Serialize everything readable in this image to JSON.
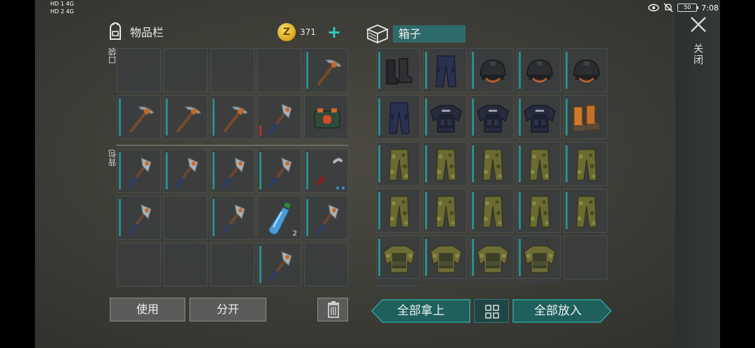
{
  "status": {
    "signal_a": "HD 1  4G",
    "signal_b": "HD 2  4G",
    "battery": "50",
    "time": "7:08"
  },
  "inventory": {
    "title": "物品栏",
    "coins": "371",
    "pocket_label": "口袋",
    "backpack_label": "背包",
    "pocket_slots": [
      {
        "item": "empty"
      },
      {
        "item": "empty"
      },
      {
        "item": "empty"
      },
      {
        "item": "empty"
      },
      {
        "item": "pickaxe",
        "bar": "teal"
      },
      {
        "item": "pickaxe",
        "bar": "teal"
      },
      {
        "item": "pickaxe",
        "bar": "teal"
      },
      {
        "item": "pickaxe",
        "bar": "teal"
      },
      {
        "item": "axe",
        "bar": "red"
      },
      {
        "item": "medkit"
      }
    ],
    "backpack_slots": [
      {
        "item": "axe",
        "bar": "teal"
      },
      {
        "item": "axe",
        "bar": "teal"
      },
      {
        "item": "axe",
        "bar": "teal"
      },
      {
        "item": "axe",
        "bar": "teal"
      },
      {
        "item": "crowbar",
        "bar": "teal"
      },
      {
        "item": "axe",
        "bar": "teal"
      },
      {
        "item": "empty"
      },
      {
        "item": "axe",
        "bar": "teal"
      },
      {
        "item": "water-bottle",
        "qty": "2"
      },
      {
        "item": "axe",
        "bar": "teal"
      },
      {
        "item": "empty"
      },
      {
        "item": "empty"
      },
      {
        "item": "empty"
      },
      {
        "item": "axe",
        "bar": "teal"
      },
      {
        "item": "empty"
      }
    ],
    "use_label": "使用",
    "split_label": "分开"
  },
  "box": {
    "title": "箱子",
    "slots": [
      {
        "item": "boots-black",
        "bar": "teal"
      },
      {
        "item": "pants-navy",
        "bar": "teal"
      },
      {
        "item": "helmet",
        "bar": "teal"
      },
      {
        "item": "helmet",
        "bar": "teal"
      },
      {
        "item": "helmet",
        "bar": "teal"
      },
      {
        "item": "pants-navy",
        "bar": "teal"
      },
      {
        "item": "vest-navy",
        "bar": "teal"
      },
      {
        "item": "vest-navy",
        "bar": "teal"
      },
      {
        "item": "vest-navy",
        "bar": "teal"
      },
      {
        "item": "boots-orange",
        "bar": "teal"
      },
      {
        "item": "pants-camo",
        "bar": "teal"
      },
      {
        "item": "pants-camo",
        "bar": "teal"
      },
      {
        "item": "pants-camo",
        "bar": "teal"
      },
      {
        "item": "pants-camo",
        "bar": "teal"
      },
      {
        "item": "pants-camo",
        "bar": "teal"
      },
      {
        "item": "pants-camo",
        "bar": "teal"
      },
      {
        "item": "pants-camo",
        "bar": "teal"
      },
      {
        "item": "pants-camo",
        "bar": "teal"
      },
      {
        "item": "pants-camo",
        "bar": "teal"
      },
      {
        "item": "pants-camo",
        "bar": "teal"
      },
      {
        "item": "jacket-camo",
        "bar": "teal"
      },
      {
        "item": "jacket-camo",
        "bar": "teal"
      },
      {
        "item": "jacket-camo",
        "bar": "teal"
      },
      {
        "item": "jacket-camo",
        "bar": "teal"
      },
      {
        "item": "empty"
      }
    ],
    "take_all_label": "全部拿上",
    "put_all_label": "全部放入"
  },
  "close_label": "关闭",
  "colors": {
    "accent": "#2fd3c6",
    "teal_button": "#1f5f5c",
    "durability_teal": "#2a8e8b",
    "durability_red": "#b7322e"
  }
}
